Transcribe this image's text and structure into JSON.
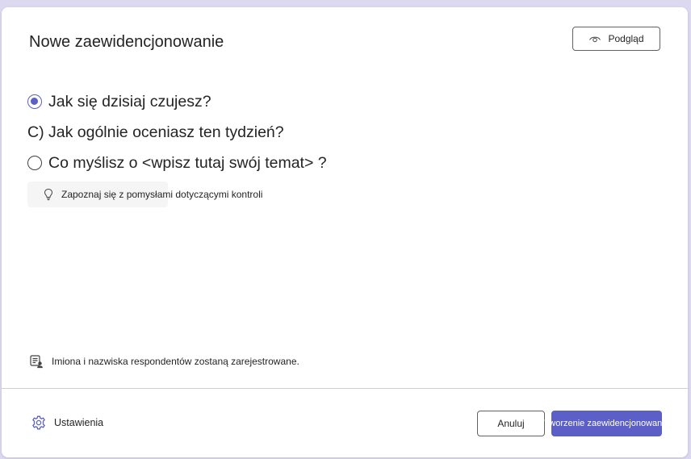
{
  "dialog": {
    "title": "Nowe zaewidencjonowanie",
    "preview_label": "Podgląd"
  },
  "options": [
    {
      "label": "Jak się dzisiaj czujesz?",
      "state": "selected"
    },
    {
      "label": "C) Jak ogólnie oceniasz ten tydzień?",
      "state": "unselected-no-radio"
    },
    {
      "label": "Co myślisz o <wpisz tutaj swój temat> ?",
      "state": "unselected"
    }
  ],
  "ideas_button": {
    "label": "Zapoznaj się z pomysłami dotyczącymi kontroli",
    "icon": "lightbulb-icon"
  },
  "notice": {
    "text": "Imiona i nazwiska respondentów zostaną zarejestrowane.",
    "icon": "person-list-icon"
  },
  "footer": {
    "settings_label": "Ustawienia",
    "cancel_label": "Anuluj",
    "create_label": "Tworzenie zaewidencjonowania"
  },
  "colors": {
    "accent": "#5b5fc7",
    "backdrop": "#dcd8f0"
  }
}
